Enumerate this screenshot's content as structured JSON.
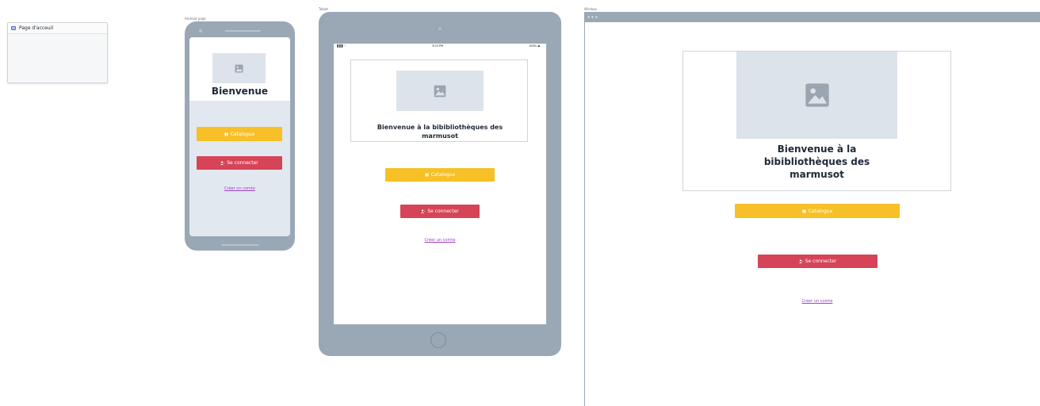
{
  "page_card": {
    "label": "Page d'acceuil"
  },
  "frames": {
    "phone_label": "Android page",
    "tablet_label": "Tablet",
    "window_label": "Window"
  },
  "phone": {
    "title": "Bienvenue",
    "catalogue_label": "Catalogue",
    "login_label": "Se connecter",
    "signup_link": "Créer un comte"
  },
  "tablet": {
    "status": {
      "left": "▐▐▐ ◠",
      "time": "3:03 PM",
      "battery": "100% ▬"
    },
    "title": "Bienvenue à la bibibliothèques des marmusot",
    "catalogue_label": "Catalogue",
    "login_label": "Se connecter",
    "signup_link": "Créer un comte"
  },
  "window": {
    "title": "Bienvenue à la bibibliothèques des marmusot",
    "catalogue_label": "Catalogue",
    "login_label": "Se connecter",
    "signup_link": "Créer un comte"
  },
  "icons": {
    "image_placeholder": "image-icon",
    "book": "book-icon",
    "user": "user-icon"
  },
  "colors": {
    "device_frame": "#9aa7b4",
    "image_placeholder": "#dde3ea",
    "catalogue_button": "#f6c026",
    "login_button": "#d64457",
    "link": "#a13ec5",
    "page_icon": "#5a67d8"
  }
}
